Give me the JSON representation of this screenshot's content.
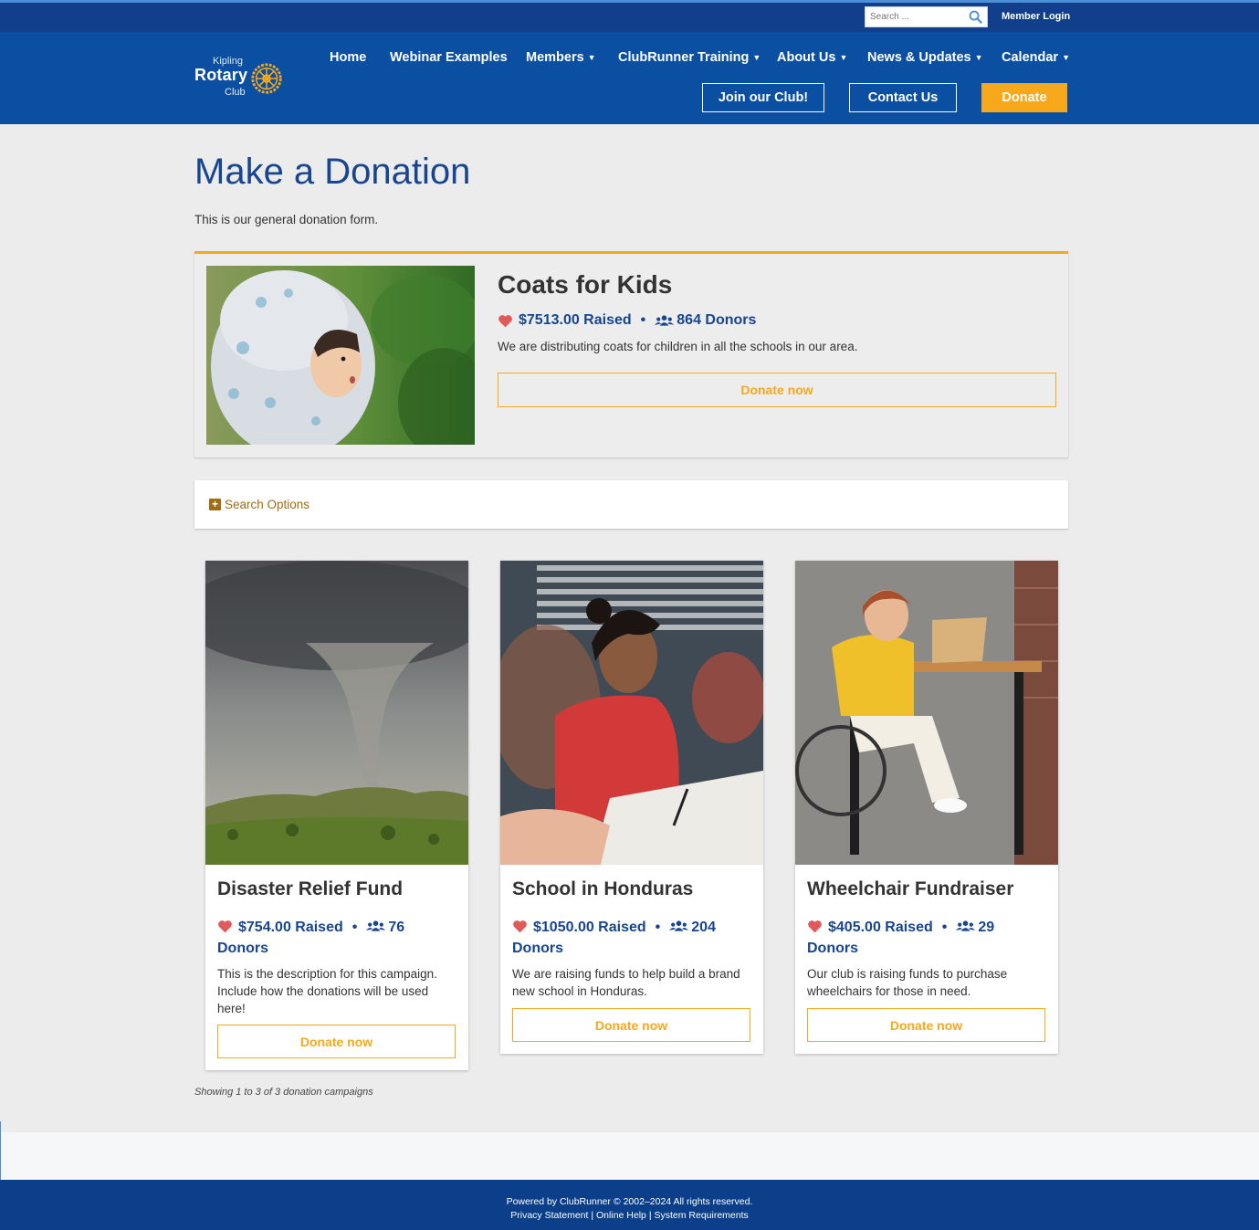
{
  "topbar": {
    "search_placeholder": "Search ...",
    "member_login": "Member Login"
  },
  "logo": {
    "line1": "Kipling",
    "line2": "Rotary",
    "line3": "Club"
  },
  "nav": [
    {
      "label": "Home"
    },
    {
      "label": "Webinar Examples"
    },
    {
      "label": "Members",
      "dropdown": true
    },
    {
      "label": "ClubRunner Training",
      "dropdown": true
    },
    {
      "label": "About Us",
      "dropdown": true
    },
    {
      "label": "News & Updates",
      "dropdown": true
    },
    {
      "label": "Calendar",
      "dropdown": true
    }
  ],
  "header_buttons": {
    "join": "Join our Club!",
    "contact": "Contact Us",
    "donate": "Donate"
  },
  "page": {
    "title": "Make a Donation",
    "intro": "This is our general donation form."
  },
  "featured": {
    "title": "Coats for Kids",
    "raised": "$7513.00 Raised",
    "donors": "864 Donors",
    "description": "We are distributing coats for children in all the schools in our area.",
    "button": "Donate now"
  },
  "search_options": {
    "label": "Search Options"
  },
  "campaigns": [
    {
      "title": "Disaster Relief Fund",
      "raised": "$754.00 Raised",
      "donors_count": "76",
      "donors_label": "Donors",
      "description": "This is the description for this campaign. Include how the donations will be used here!",
      "button": "Donate now"
    },
    {
      "title": "School in Honduras",
      "raised": "$1050.00 Raised",
      "donors_count": "204",
      "donors_label": "Donors",
      "description": "We are raising funds to help build a brand new school in Honduras.",
      "button": "Donate now"
    },
    {
      "title": "Wheelchair Fundraiser",
      "raised": "$405.00 Raised",
      "donors_count": "29",
      "donors_label": "Donors",
      "description": "Our club is raising funds to purchase wheelchairs for those in need.",
      "button": "Donate now"
    }
  ],
  "showing": "Showing 1 to 3 of 3 donation campaigns",
  "footer": {
    "powered": "Powered by ClubRunner © 2002–2024  All rights reserved.",
    "links": [
      "Privacy Statement",
      "Online Help",
      "System Requirements"
    ]
  },
  "colors": {
    "brand_blue": "#0b4fa2",
    "topbar_blue": "#113f8c",
    "gold": "#f7a81b",
    "title_blue": "#17458f",
    "heart_red": "#e05a5a"
  }
}
